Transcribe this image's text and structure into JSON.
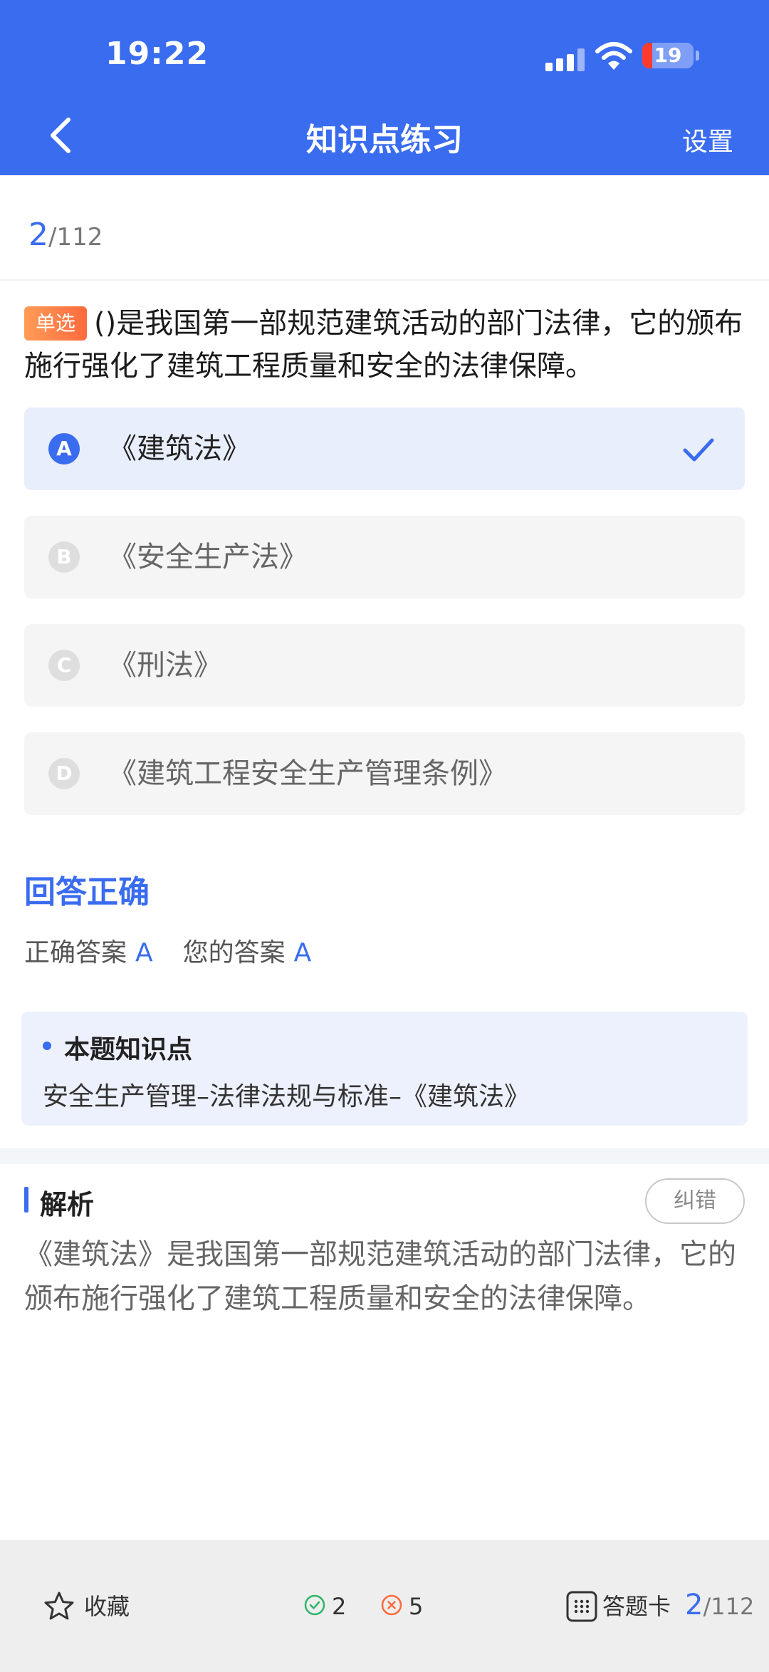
{
  "status_bar": {
    "time": "19:22",
    "battery": "19"
  },
  "header": {
    "title": "知识点练习",
    "settings_label": "设置"
  },
  "progress": {
    "current": "2",
    "total": "/112"
  },
  "question": {
    "type_tag": "单选",
    "text": "()是我国第一部规范建筑活动的部门法律，它的颁布施行强化了建筑工程质量和安全的法律保障。"
  },
  "options": [
    {
      "letter": "A",
      "text": "《建筑法》",
      "selected": true
    },
    {
      "letter": "B",
      "text": "《安全生产法》",
      "selected": false
    },
    {
      "letter": "C",
      "text": "《刑法》",
      "selected": false
    },
    {
      "letter": "D",
      "text": "《建筑工程安全生产管理条例》",
      "selected": false
    }
  ],
  "result": {
    "status": "回答正确",
    "correct_label": "正确答案",
    "correct_answer": "A",
    "your_label": "您的答案",
    "your_answer": "A"
  },
  "knowledge_point": {
    "title": "本题知识点",
    "text": "安全生产管理–法律法规与标准–《建筑法》"
  },
  "analysis": {
    "title": "解析",
    "report_label": "纠错",
    "text": "《建筑法》是我国第一部规范建筑活动的部门法律，它的颁布施行强化了建筑工程质量和安全的法律保障。"
  },
  "bottom_bar": {
    "favorite_label": "收藏",
    "correct_count": "2",
    "wrong_count": "5",
    "answer_card_label": "答题卡",
    "current": "2",
    "total": "/112"
  },
  "colors": {
    "accent": "#3a6cf0",
    "tag": "#ff7a45",
    "wrong": "#ff6a3d",
    "right": "#2fb56a"
  }
}
